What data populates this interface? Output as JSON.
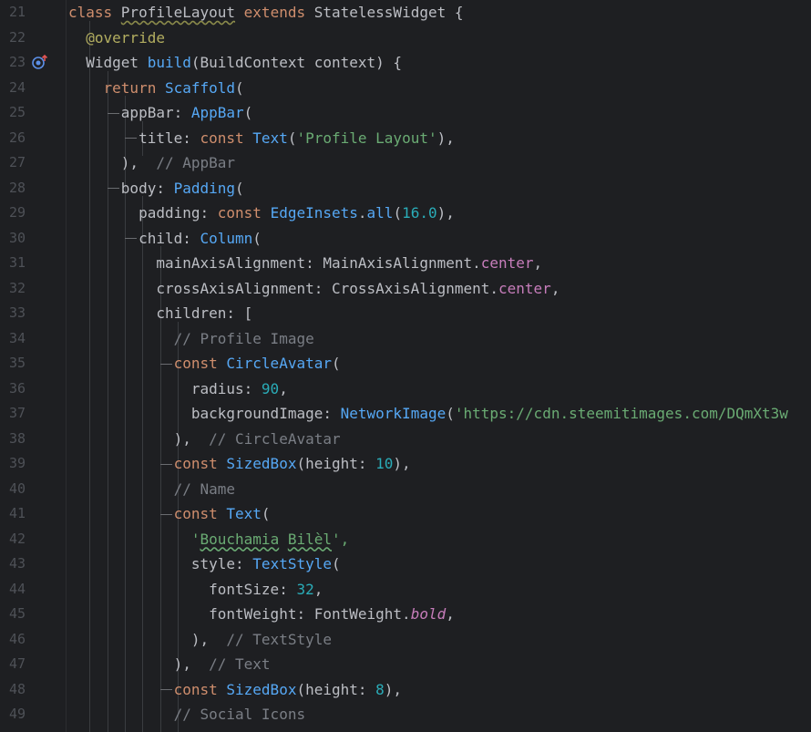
{
  "editor": {
    "line_numbers": [
      "21",
      "22",
      "23",
      "24",
      "25",
      "26",
      "27",
      "28",
      "29",
      "30",
      "31",
      "32",
      "33",
      "34",
      "35",
      "36",
      "37",
      "38",
      "39",
      "40",
      "41",
      "42",
      "43",
      "44",
      "45",
      "46",
      "47",
      "48",
      "49"
    ],
    "gutter_icons": [
      {
        "line": "23",
        "icon": "override-method-icon"
      }
    ],
    "lines": [
      {
        "segments": [
          {
            "t": "class ",
            "c": "kw"
          },
          {
            "t": "ProfileLayout",
            "c": "plain squiggle"
          },
          {
            "t": " extends ",
            "c": "kw"
          },
          {
            "t": "StatelessWidget {",
            "c": "plain"
          }
        ]
      },
      {
        "segments": [
          {
            "t": "  "
          },
          {
            "t": "@override",
            "c": "annot"
          }
        ]
      },
      {
        "segments": [
          {
            "t": "  Widget "
          },
          {
            "t": "build",
            "c": "cls"
          },
          {
            "t": "(BuildContext context) {"
          }
        ]
      },
      {
        "segments": [
          {
            "t": "    "
          },
          {
            "t": "return ",
            "c": "kw"
          },
          {
            "t": "Scaffold",
            "c": "cls"
          },
          {
            "t": "("
          }
        ]
      },
      {
        "segments": [
          {
            "t": "      appBar: "
          },
          {
            "t": "AppBar",
            "c": "cls"
          },
          {
            "t": "("
          }
        ]
      },
      {
        "segments": [
          {
            "t": "        title: "
          },
          {
            "t": "const ",
            "c": "kw"
          },
          {
            "t": "Text",
            "c": "cls"
          },
          {
            "t": "("
          },
          {
            "t": "'Profile Layout'",
            "c": "str"
          },
          {
            "t": "),"
          }
        ]
      },
      {
        "segments": [
          {
            "t": "      ),  "
          },
          {
            "t": "// AppBar",
            "c": "cmt"
          }
        ]
      },
      {
        "segments": [
          {
            "t": "      body: "
          },
          {
            "t": "Padding",
            "c": "cls"
          },
          {
            "t": "("
          }
        ]
      },
      {
        "segments": [
          {
            "t": "        padding: "
          },
          {
            "t": "const ",
            "c": "kw"
          },
          {
            "t": "EdgeInsets",
            "c": "cls"
          },
          {
            "t": "."
          },
          {
            "t": "all",
            "c": "cls"
          },
          {
            "t": "("
          },
          {
            "t": "16.0",
            "c": "num"
          },
          {
            "t": "),"
          }
        ]
      },
      {
        "segments": [
          {
            "t": "        child: "
          },
          {
            "t": "Column",
            "c": "cls"
          },
          {
            "t": "("
          }
        ]
      },
      {
        "segments": [
          {
            "t": "          mainAxisAlignment: MainAxisAlignment."
          },
          {
            "t": "center",
            "c": "field"
          },
          {
            "t": ","
          }
        ]
      },
      {
        "segments": [
          {
            "t": "          crossAxisAlignment: CrossAxisAlignment."
          },
          {
            "t": "center",
            "c": "field"
          },
          {
            "t": ","
          }
        ]
      },
      {
        "segments": [
          {
            "t": "          children: ["
          }
        ]
      },
      {
        "segments": [
          {
            "t": "            "
          },
          {
            "t": "// Profile Image",
            "c": "cmt"
          }
        ]
      },
      {
        "segments": [
          {
            "t": "            "
          },
          {
            "t": "const ",
            "c": "kw"
          },
          {
            "t": "CircleAvatar",
            "c": "cls"
          },
          {
            "t": "("
          }
        ]
      },
      {
        "segments": [
          {
            "t": "              radius: "
          },
          {
            "t": "90",
            "c": "num"
          },
          {
            "t": ","
          }
        ]
      },
      {
        "segments": [
          {
            "t": "              backgroundImage: "
          },
          {
            "t": "NetworkImage",
            "c": "cls"
          },
          {
            "t": "("
          },
          {
            "t": "'https://cdn.steemitimages.com/DQmXt3w",
            "c": "str"
          }
        ]
      },
      {
        "segments": [
          {
            "t": "            ),  "
          },
          {
            "t": "// CircleAvatar",
            "c": "cmt"
          }
        ]
      },
      {
        "segments": [
          {
            "t": "            "
          },
          {
            "t": "const ",
            "c": "kw"
          },
          {
            "t": "SizedBox",
            "c": "cls"
          },
          {
            "t": "(height: "
          },
          {
            "t": "10",
            "c": "num"
          },
          {
            "t": "),"
          }
        ]
      },
      {
        "segments": [
          {
            "t": "            "
          },
          {
            "t": "// Name",
            "c": "cmt"
          }
        ]
      },
      {
        "segments": [
          {
            "t": "            "
          },
          {
            "t": "const ",
            "c": "kw"
          },
          {
            "t": "Text",
            "c": "cls"
          },
          {
            "t": "("
          }
        ]
      },
      {
        "segments": [
          {
            "t": "              "
          },
          {
            "t": "'",
            "c": "str"
          },
          {
            "t": "Bouchamia",
            "c": "str squiggle-g"
          },
          {
            "t": " ",
            "c": "str"
          },
          {
            "t": "Bilèl",
            "c": "str squiggle-g"
          },
          {
            "t": "',",
            "c": "str"
          }
        ]
      },
      {
        "segments": [
          {
            "t": "              style: "
          },
          {
            "t": "TextStyle",
            "c": "cls"
          },
          {
            "t": "("
          }
        ]
      },
      {
        "segments": [
          {
            "t": "                fontSize: "
          },
          {
            "t": "32",
            "c": "num"
          },
          {
            "t": ","
          }
        ]
      },
      {
        "segments": [
          {
            "t": "                fontWeight: FontWeight."
          },
          {
            "t": "bold",
            "c": "field italic"
          },
          {
            "t": ","
          }
        ]
      },
      {
        "segments": [
          {
            "t": "              ),  "
          },
          {
            "t": "// TextStyle",
            "c": "cmt"
          }
        ]
      },
      {
        "segments": [
          {
            "t": "            ),  "
          },
          {
            "t": "// Text",
            "c": "cmt"
          }
        ]
      },
      {
        "segments": [
          {
            "t": "            "
          },
          {
            "t": "const ",
            "c": "kw"
          },
          {
            "t": "SizedBox",
            "c": "cls"
          },
          {
            "t": "(height: "
          },
          {
            "t": "8",
            "c": "num"
          },
          {
            "t": "),"
          }
        ]
      },
      {
        "segments": [
          {
            "t": "            "
          },
          {
            "t": "// Social Icons",
            "c": "cmt"
          }
        ]
      }
    ]
  }
}
